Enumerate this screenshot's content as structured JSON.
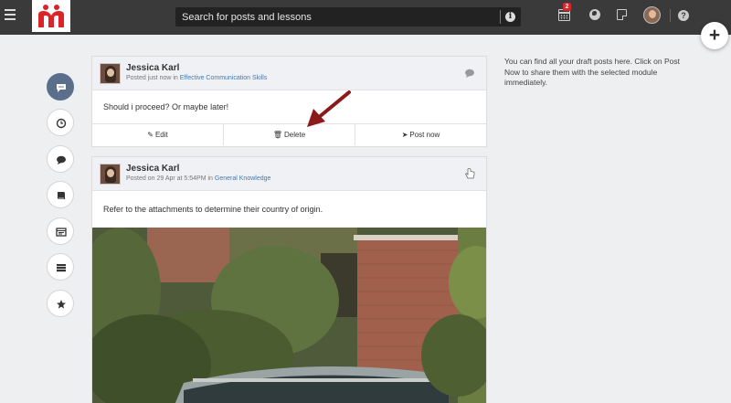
{
  "topbar": {
    "search_placeholder": "Search for posts and lessons",
    "calendar_badge": "2",
    "icons": [
      "menu-icon",
      "logo-icon",
      "info-icon",
      "calendar-icon",
      "globe-icon",
      "note-icon",
      "avatar",
      "help-icon",
      "plus-icon"
    ],
    "help_label": "?",
    "info_label": "i",
    "fab_label": "+"
  },
  "rail": {
    "items": [
      "chat-bubble-icon",
      "clock-icon",
      "comment-icon",
      "book-icon",
      "browser-icon",
      "list-icon",
      "star-icon"
    ],
    "active_index": 0
  },
  "posts": [
    {
      "author": "Jessica Karl",
      "meta_prefix": "Posted just now in ",
      "module": "Effective Communication Skills",
      "body": "Should i proceed? Or maybe later!",
      "actions": {
        "edit": "Edit",
        "delete": "Delete",
        "post_now": "Post now"
      }
    },
    {
      "author": "Jessica Karl",
      "meta_prefix": "Posted on 29 Apr at 5:54PM in ",
      "module": "General Knowledge",
      "body": "Refer to the attachments to determine their country of origin."
    }
  ],
  "side_note": "You can find all your draft posts here. Click on Post Now to share them with the selected module immediately.",
  "colors": {
    "topbar": "#3a3a3a",
    "active_rail": "#5b6f8c",
    "link": "#3c7cb8",
    "badge": "#d9242a",
    "arrow": "#8b1a1a",
    "logo": "#d9242a"
  }
}
